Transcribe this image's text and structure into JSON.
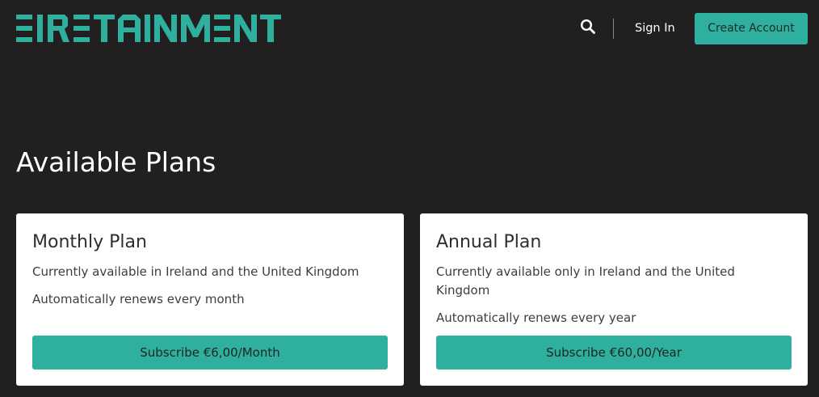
{
  "header": {
    "logo_text": "EIRETAINMENT",
    "logo_icon": "eiretainment-logo",
    "search_icon": "search-icon",
    "signin_label": "Sign In",
    "create_account_label": "Create Account"
  },
  "main": {
    "title": "Available Plans",
    "plans": [
      {
        "name": "Monthly Plan",
        "availability": "Currently available in Ireland and the United Kingdom",
        "renewal": "Automatically renews every month",
        "cta": "Subscribe €6,00/Month"
      },
      {
        "name": "Annual Plan",
        "availability": "Currently available only in Ireland and the United Kingdom",
        "renewal": "Automatically renews every year",
        "cta": "Subscribe €60,00/Year"
      }
    ]
  },
  "colors": {
    "background": "#221f20",
    "accent": "#2fb09f",
    "card": "#ffffff"
  }
}
